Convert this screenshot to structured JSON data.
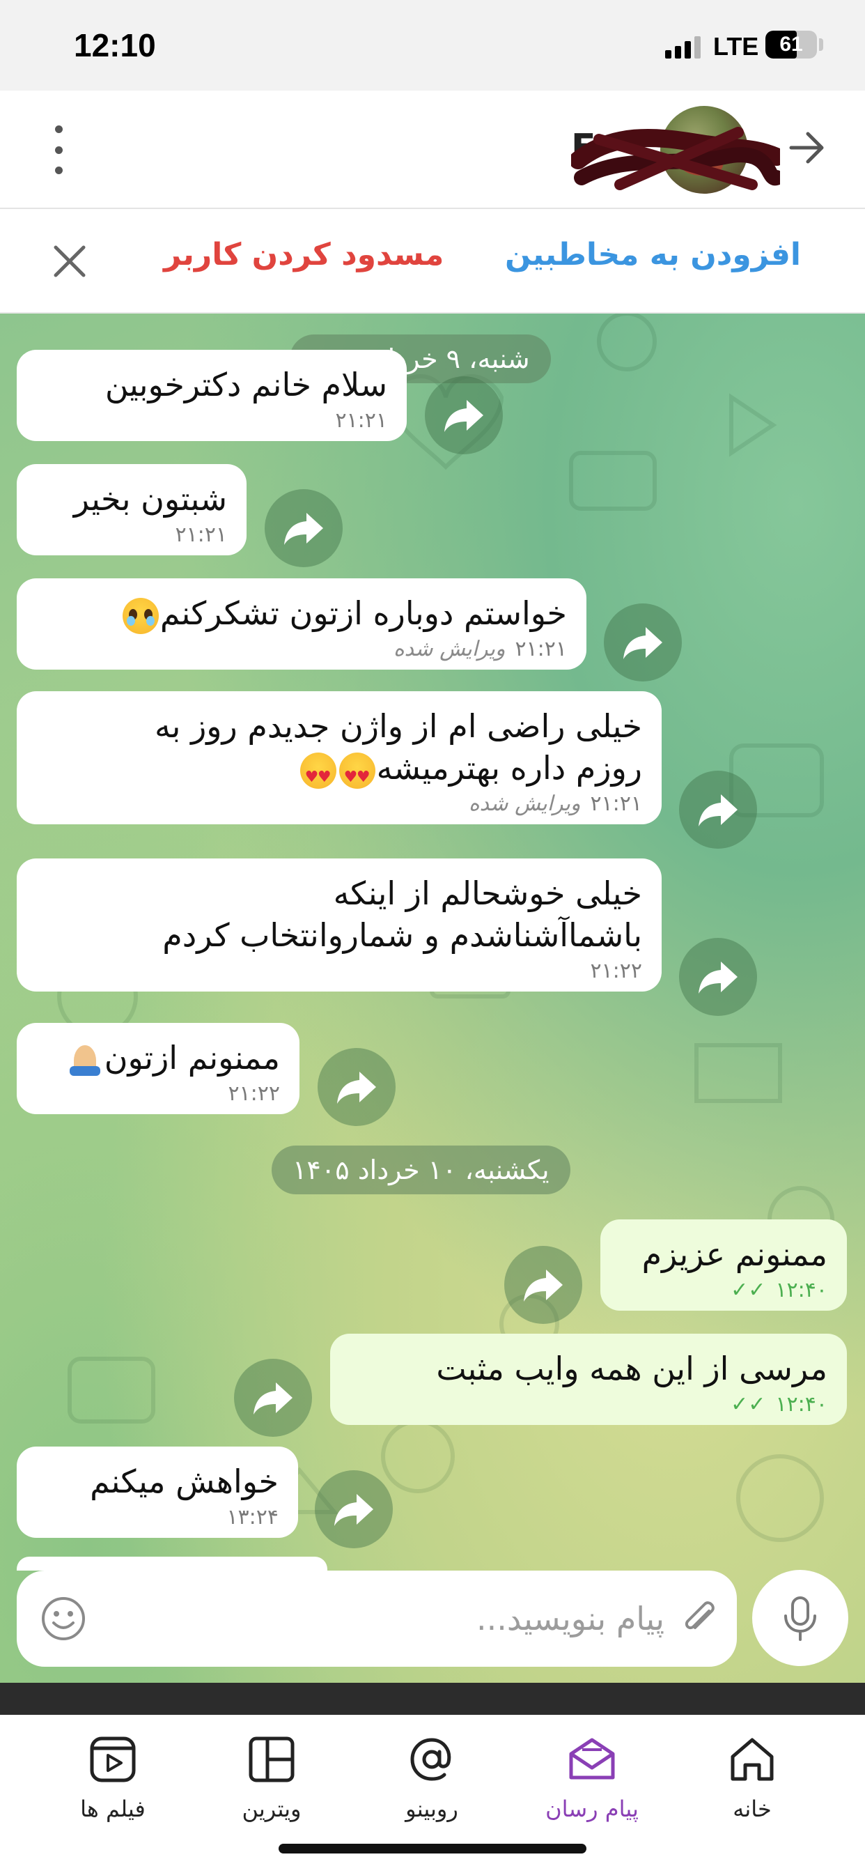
{
  "status_bar": {
    "time": "12:10",
    "network": "LTE",
    "battery": "61",
    "battery_level": 0.61
  },
  "header": {
    "contact_name": "E"
  },
  "actions": {
    "add_contact": "افزودن به مخاطبین",
    "block_user": "مسدود کردن کاربر"
  },
  "chat": {
    "date_1": "شنبه، ۹ خرداد ۱۴۰۵",
    "date_2": "یکشنبه، ۱۰ خرداد ۱۴۰۵",
    "edited_label": "ویرایش شده",
    "messages": [
      {
        "text": "سلام خانم دکترخوبین",
        "time": "۲۱:۲۱",
        "direction": "in"
      },
      {
        "text": "شبتون بخیر",
        "time": "۲۱:۲۱",
        "direction": "in"
      },
      {
        "text": "خواستم دوباره ازتون تشکرکنم",
        "time": "۲۱:۲۱",
        "direction": "in",
        "edited": true,
        "emoji": "pleading-face"
      },
      {
        "text_line1": "خیلی راضی ام از واژن جدیدم روز به",
        "text_line2": "روزم داره بهترمیشه",
        "time": "۲۱:۲۱",
        "direction": "in",
        "edited": true,
        "emoji": "heart-eyes x2"
      },
      {
        "text_line1": "خیلی خوشحالم از اینکه",
        "text_line2": "باشماآشناشدم و شماروانتخاب کردم",
        "time": "۲۱:۲۲",
        "direction": "in"
      },
      {
        "text": "ممنونم ازتون",
        "time": "۲۱:۲۲",
        "direction": "in",
        "emoji": "folded-hands"
      },
      {
        "text": "ممنونم عزیزم",
        "time": "۱۲:۴۰",
        "direction": "out"
      },
      {
        "text": "مرسی از این همه وایب مثبت",
        "time": "۱۲:۴۰",
        "direction": "out"
      },
      {
        "text": "خواهش میکنم",
        "time": "۱۳:۲۴",
        "direction": "in"
      }
    ]
  },
  "composer": {
    "placeholder": "پیام بنویسید..."
  },
  "tabs": [
    {
      "label": "فیلم ها",
      "icon": "video-icon"
    },
    {
      "label": "ویترین",
      "icon": "grid-icon"
    },
    {
      "label": "روبینو",
      "icon": "at-icon"
    },
    {
      "label": "پیام رسان",
      "icon": "messenger-icon",
      "active": true
    },
    {
      "label": "خانه",
      "icon": "home-icon"
    }
  ],
  "colors": {
    "accent_purple": "#8a3fb5",
    "block_red": "#e0443e",
    "add_blue": "#3b95e0",
    "outgoing_bubble": "#eefcdc"
  }
}
